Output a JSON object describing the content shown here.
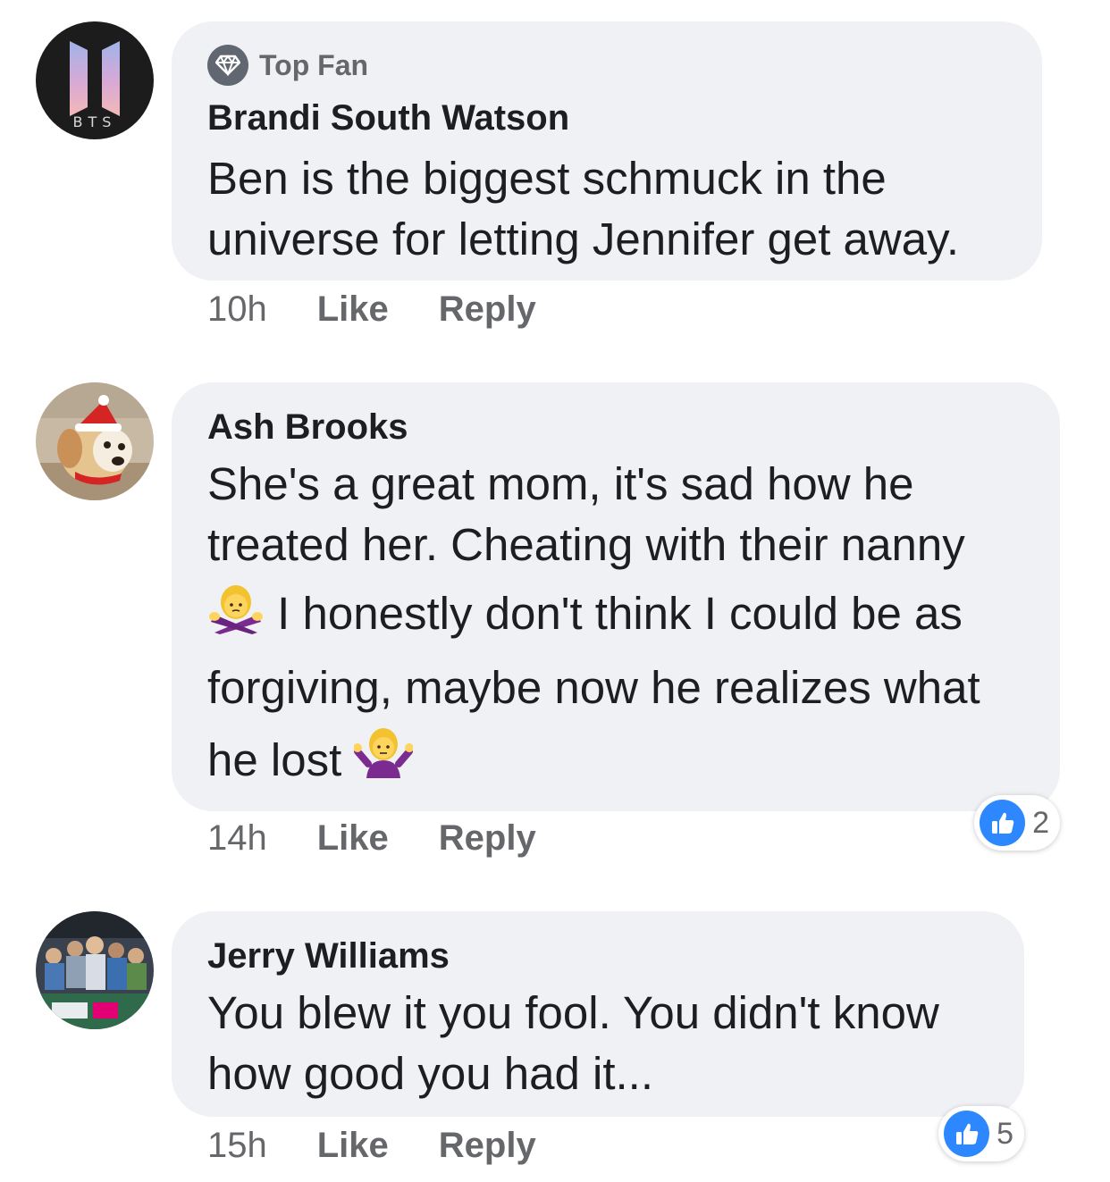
{
  "colors": {
    "bubble": "#f0f1f4",
    "meta_text": "#65676b",
    "like_blue": "#2d88ff"
  },
  "comments": [
    {
      "avatar": "bts-logo-avatar",
      "avatar_text": "BTS",
      "badge": {
        "icon": "diamond-icon",
        "label": "Top Fan"
      },
      "author": "Brandi South Watson",
      "lines": [
        "Ben is the biggest schmuck in the",
        "universe for letting Jennifer get away."
      ],
      "time": "10h",
      "like_label": "Like",
      "reply_label": "Reply"
    },
    {
      "avatar": "puppy-photo-avatar",
      "author": "Ash Brooks",
      "lines": [
        "She's a great mom, it's sad how he",
        "treated her. Cheating with their nanny",
        "I honestly don't think I could be as",
        "forgiving, maybe now he realizes what",
        "he lost"
      ],
      "emojis": [
        "woman-gesturing-no-emoji",
        "woman-shrugging-emoji"
      ],
      "time": "14h",
      "like_label": "Like",
      "reply_label": "Reply",
      "reactions": {
        "icon": "thumbs-up-icon",
        "count": "2"
      }
    },
    {
      "avatar": "stadium-crowd-avatar",
      "author": "Jerry Williams",
      "lines": [
        "You blew it you fool. You didn't know",
        "how good you had it..."
      ],
      "time": "15h",
      "like_label": "Like",
      "reply_label": "Reply",
      "reactions": {
        "icon": "thumbs-up-icon",
        "count": "5"
      }
    }
  ]
}
